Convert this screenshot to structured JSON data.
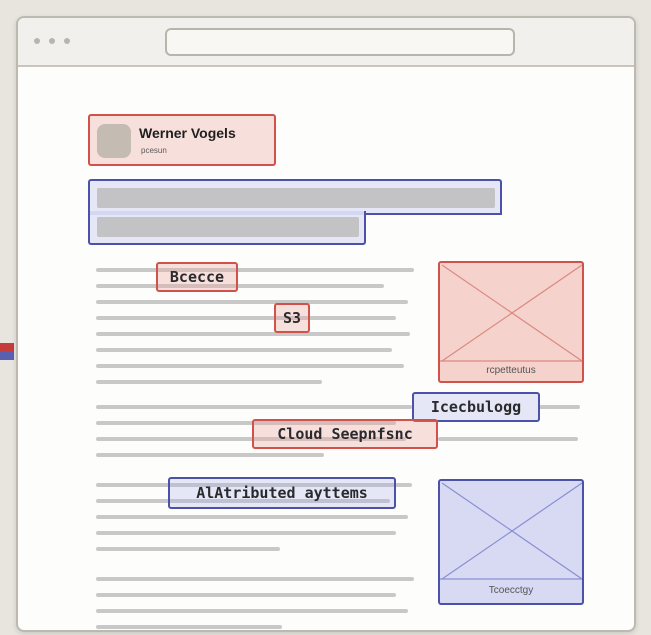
{
  "window": {
    "title": "",
    "address": ""
  },
  "author": {
    "name": "Werner Vogels",
    "role": "pcesun"
  },
  "tags": [
    {
      "text": "Bcecce",
      "color": "red"
    },
    {
      "text": "S3",
      "color": "red"
    },
    {
      "text": "Icecbulogg",
      "color": "blue"
    },
    {
      "text": "Cloud Seepnfsnc",
      "color": "red"
    },
    {
      "text": "AlAtributed ayttems",
      "color": "blue"
    }
  ],
  "images": [
    {
      "caption": "rcpetteutus",
      "color": "red"
    },
    {
      "caption": "Tcoecctgy",
      "color": "blue"
    }
  ],
  "colors": {
    "red_accent": "#d0524a",
    "blue_accent": "#4b52a8",
    "text_line": "#c8c8c8"
  }
}
